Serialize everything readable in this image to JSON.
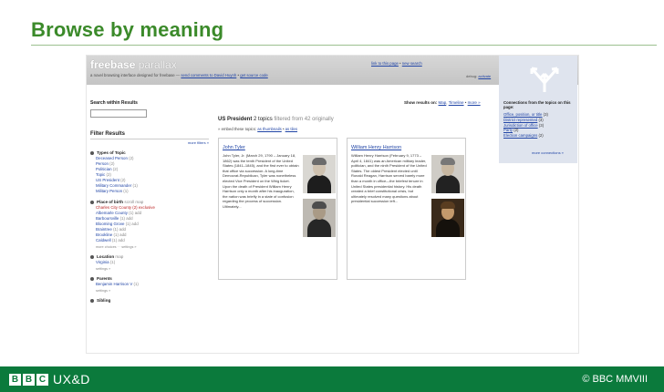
{
  "slide": {
    "title": "Browse by meaning",
    "footer_brand": [
      "B",
      "B",
      "C"
    ],
    "footer_group": "UX&D",
    "copyright": "© BBC MMVIII"
  },
  "app": {
    "logo_main": "freebase",
    "logo_sub": " parallax",
    "tagline_pre": "a novel browsing interface designed for freebase — ",
    "tagline_link1": "send comments to David Huynh",
    "tagline_sep": " • ",
    "tagline_link2": "get source code",
    "top_link1": "link to this page",
    "top_link1_sep": " • ",
    "top_link2": "new search",
    "debug_label": "debug: ",
    "debug_link": "activate"
  },
  "sidebar": {
    "search_label": "Search within Results",
    "search_placeholder": "",
    "filter_title": "Filter Results",
    "more_filters": "more filters »",
    "facets": [
      {
        "label": "Types of Topic",
        "note": "",
        "items": [
          {
            "name": "Deceased Person",
            "count": "(2)"
          },
          {
            "name": "Person",
            "count": "(2)"
          },
          {
            "name": "Politician",
            "count": "(2)"
          },
          {
            "name": "Topic",
            "count": "(2)"
          },
          {
            "name": "US President",
            "count": "(2)"
          },
          {
            "name": "Military Commander",
            "count": "(1)"
          },
          {
            "name": "Military Person",
            "count": "(1)"
          }
        ],
        "foot": ""
      },
      {
        "label": "Place of birth",
        "note": "scroll map",
        "items": [
          {
            "name": "Charles City County",
            "count": "(2) exclusive",
            "selected": true
          },
          {
            "name": "Albemarle County",
            "count": "(1) add"
          },
          {
            "name": "Barboursville",
            "count": "(1) add"
          },
          {
            "name": "Blooming Grove",
            "count": "(1) add"
          },
          {
            "name": "Braintree",
            "count": "(1) add"
          },
          {
            "name": "Brookline",
            "count": "(1) add"
          },
          {
            "name": "Caldwell",
            "count": "(1) add"
          }
        ],
        "foot": "more choices · · settings »"
      },
      {
        "label": "Location",
        "note": "map",
        "items": [
          {
            "name": "Virginia",
            "count": "(1)"
          }
        ],
        "foot": "settings »"
      },
      {
        "label": "Parents",
        "note": "",
        "items": [
          {
            "name": "Benjamin Harrison V",
            "count": "(1)"
          }
        ],
        "foot": "settings »"
      },
      {
        "label": "Sibling",
        "note": "",
        "items": [],
        "foot": ""
      }
    ]
  },
  "main": {
    "show_label": "Show results on: ",
    "show_opt1": "Map",
    "show_opt2": "Timeline",
    "show_opt3": "more »",
    "heading_type": "US President",
    "heading_count": "2 topics",
    "heading_sub": "filtered from 42 originally",
    "embed_pre": "» embed these topics: ",
    "embed_link1": "as thumbnails",
    "embed_sep": " • ",
    "embed_link2": "as tiles",
    "cards": [
      {
        "name": "John Tyler",
        "text": "John Tyler, Jr. (March 29, 1790 – January 18, 1862) was the tenth President of the United States (1841–1845), and the first ever to obtain that office via succession. A long-time Democrat-Republican, Tyler was nonetheless elected Vice President on the Whig ticket. Upon the death of President William Henry Harrison only a month after his inauguration, the nation was briefly in a state of confusion regarding the process of succession. Ultimately..."
      },
      {
        "name": "William Henry Harrison",
        "text": "William Henry Harrison (February 9, 1773 – April 4, 1841) was an American military leader, politician, and the ninth President of the United States. The oldest President elected until Ronald Reagan, Harrison served barely more than a month in office—the briefest tenure in United States presidential history. His death created a brief constitutional crisis, but ultimately resolved many questions about presidential succession left..."
      }
    ]
  },
  "connections": {
    "title": "Connections from the topics on this page:",
    "items": [
      {
        "name": "Office, position, or title",
        "count": "(3)"
      },
      {
        "name": "District represented",
        "count": "(3)"
      },
      {
        "name": "Jurisdiction of office",
        "count": "(3)"
      },
      {
        "name": "Party",
        "count": "(2)"
      },
      {
        "name": "Election campaigns",
        "count": "(2)"
      }
    ],
    "more": "more connections »"
  }
}
